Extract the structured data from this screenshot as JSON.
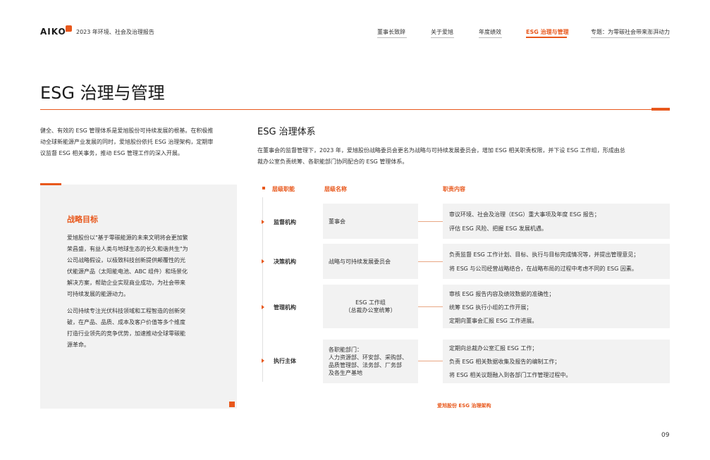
{
  "header": {
    "logo": "AIKO",
    "report_title": "2023 年环境、社会及治理报告",
    "nav": [
      {
        "label": "董事长致辞"
      },
      {
        "label": "关于爱旭"
      },
      {
        "label": "年度绩效"
      },
      {
        "label": "ESG 治理与管理"
      },
      {
        "label": "专题：为零碳社会带来澎湃动力"
      }
    ],
    "active_index": 3
  },
  "page": {
    "title": "ESG 治理与管理",
    "number": "09"
  },
  "intro": {
    "lines": [
      "健全、有效的 ESG 管理体系是爱旭股份可持续发展的根基。在积极推",
      "动全球新能源产业发展的同时，爱旭股份依托 ESG 治理架构，定期审",
      "议监督 ESG 相关事务，推动 ESG 管理工作的深入开展。"
    ]
  },
  "goal": {
    "title": "战略目标",
    "p1": [
      "爱旭股份以\"基于零碳能源的未来文明将会更加繁",
      "荣昌盛，有益人类与地球生态的长久和谐共生\"为",
      "公司战略假设，以极致科技创新提供颠覆性的光",
      "伏能源产品（太阳能电池、ABC 组件）和场景化",
      "解决方案，帮助企业实现商业成功，为社会带来",
      "可持续发展的能源动力。"
    ],
    "p2": [
      "公司持续专注光伏科技领域和工程智造的创新突",
      "破，在产品、品质、成本及客户价值等多个维度",
      "打造行业领先的竞争优势，加速推动全球零碳能",
      "源革命。"
    ]
  },
  "section": {
    "title": "ESG 治理体系",
    "desc": [
      "在董事会的监督管理下，2023 年，爱旭股份战略委员会更名为战略与可持续发展委员会，增加 ESG 相关职责权限，并下设 ESG 工作组，形成由总",
      "裁办公室负责统筹、各职能部门协同配合的 ESG 管理体系。"
    ]
  },
  "table": {
    "headers": {
      "level": "层级职能",
      "name": "层级名称",
      "duty": "职责内容"
    },
    "rows": [
      {
        "level": "监督机构",
        "name": [
          "董事会"
        ],
        "duties": [
          "审议环境、社会及治理（ESG）重大事项及年度 ESG 报告；",
          "评估 ESG 风险、把握 ESG 发展机遇。"
        ]
      },
      {
        "level": "决策机构",
        "name": [
          "战略与可持续发展委员会"
        ],
        "duties": [
          "负责监督 ESG 工作计划、目标、执行与目标完成情况等，并提出管理意见；",
          "将 ESG 与公司经营战略结合，在战略布局的过程中考虑不同的 ESG 因素。"
        ]
      },
      {
        "level": "管理机构",
        "name": [
          "ESG 工作组",
          "（总裁办公室统筹）"
        ],
        "duties": [
          "审核 ESG 报告内容及绩效数据的准确性；",
          "统筹 ESG 执行小组的工作开展；",
          "定期向董事会汇报 ESG 工作进展。"
        ]
      },
      {
        "level": "执行主体",
        "name": [
          "各职能部门：",
          "人力资源部、环安部、采购部、",
          "品质管理部、法务部、厂务部",
          "及各生产基地"
        ],
        "duties": [
          "定期向总裁办公室汇报 ESG 工作；",
          "负责 ESG 相关数据收集及报告的编制工作；",
          "将 ESG 相关议题融入到各部门工作管理过程中。"
        ]
      }
    ],
    "caption": "爱旭股份 ESG 治理架构"
  },
  "colors": {
    "accent": "#e8581c",
    "box": "#f2f2f2"
  }
}
